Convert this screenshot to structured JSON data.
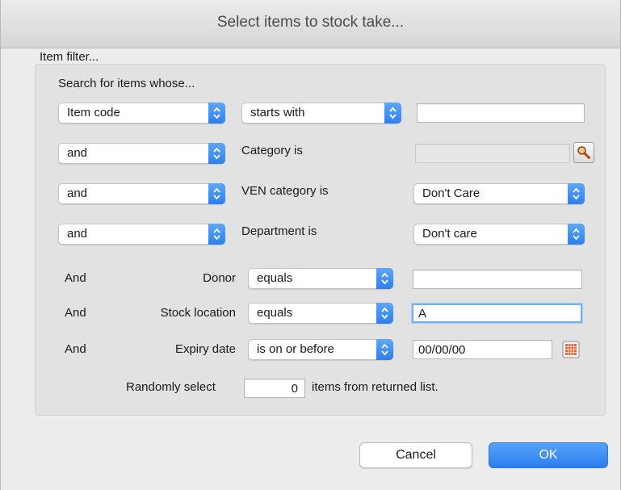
{
  "window": {
    "title": "Select items to stock take..."
  },
  "filter": {
    "group_label": "Item filter...",
    "search_heading": "Search for items whose...",
    "row1": {
      "field": "Item code",
      "operator": "starts with",
      "value": ""
    },
    "row2": {
      "conjunction": "and",
      "label": "Category is",
      "value": ""
    },
    "row3": {
      "conjunction": "and",
      "label": "VEN category is",
      "value": "Don't Care"
    },
    "row4": {
      "conjunction": "and",
      "label": "Department is",
      "value": "Don't care"
    },
    "donor": {
      "conjunction": "And",
      "label": "Donor",
      "operator": "equals",
      "value": ""
    },
    "location": {
      "conjunction": "And",
      "label": "Stock location",
      "operator": "equals",
      "value": "A"
    },
    "expiry": {
      "conjunction": "And",
      "label": "Expiry date",
      "operator": "is on or before",
      "value": "00/00/00"
    },
    "random": {
      "label_before": "Randomly select",
      "count": "0",
      "label_after": "items from returned list."
    }
  },
  "buttons": {
    "cancel": "Cancel",
    "ok": "OK"
  },
  "icons": {
    "lookup": "magnifier-icon",
    "calendar": "calendar-icon",
    "popup_arrow": "updown-arrows-icon"
  },
  "colors": {
    "accent": "#2d7ff0",
    "focus_ring": "#76aef2"
  }
}
